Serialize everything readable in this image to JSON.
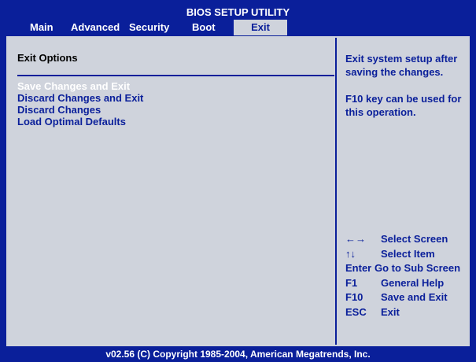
{
  "title": "BIOS SETUP UTILITY",
  "menu": {
    "tabs": [
      {
        "label": "Main"
      },
      {
        "label": "Advanced"
      },
      {
        "label": "Security"
      },
      {
        "label": "Boot"
      },
      {
        "label": "Exit"
      }
    ],
    "active_tab": "Exit"
  },
  "main": {
    "section_title": "Exit Options",
    "options": [
      {
        "label": "Save Changes and Exit",
        "selected": true
      },
      {
        "label": "Discard Changes and Exit",
        "selected": false
      },
      {
        "label": "Discard Changes",
        "selected": false
      },
      {
        "label": "Load Optimal Defaults",
        "selected": false
      }
    ]
  },
  "help": {
    "description_1": "Exit system setup after saving the changes.",
    "description_2": "F10 key can be used for this operation."
  },
  "keys": [
    {
      "key": "←→",
      "action": "Select Screen"
    },
    {
      "key": "↑↓",
      "action": "Select Item"
    },
    {
      "key": "Enter",
      "action": "Go to Sub Screen"
    },
    {
      "key": "F1",
      "action": "General Help"
    },
    {
      "key": "F10",
      "action": "Save and Exit"
    },
    {
      "key": "ESC",
      "action": "Exit"
    }
  ],
  "footer": "v02.56 (C) Copyright 1985-2004, American Megatrends, Inc.",
  "colors": {
    "background_blue": "#0a1f9a",
    "panel_gray": "#cfd3dc",
    "text_white": "#ffffff"
  }
}
